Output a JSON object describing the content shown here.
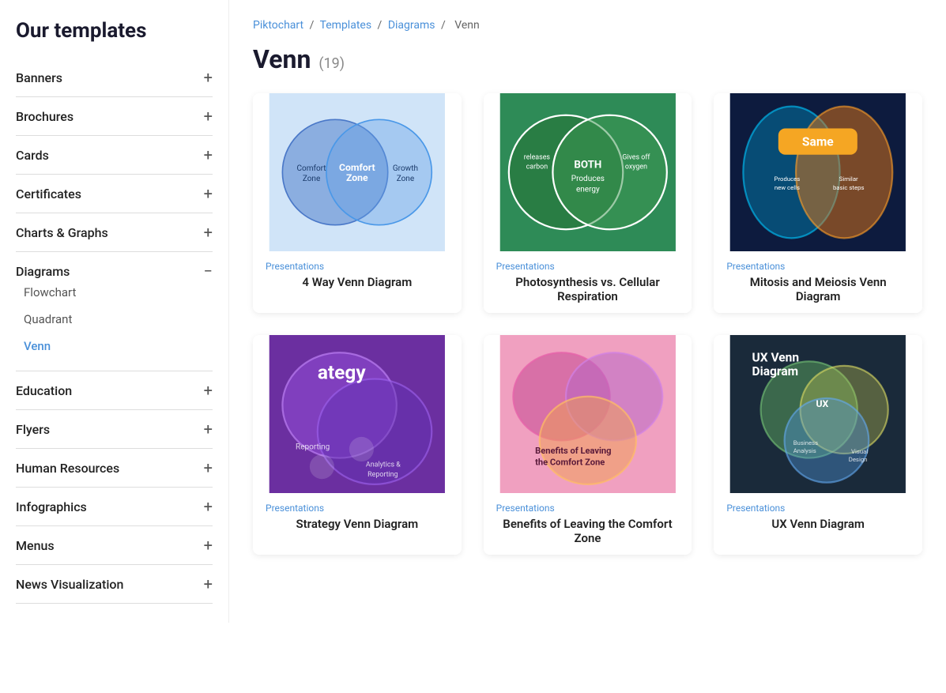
{
  "sidebar": {
    "heading": "Our templates",
    "items": [
      {
        "id": "banners",
        "label": "Banners",
        "expandable": true,
        "expanded": false,
        "subitems": []
      },
      {
        "id": "brochures",
        "label": "Brochures",
        "expandable": true,
        "expanded": false,
        "subitems": []
      },
      {
        "id": "cards",
        "label": "Cards",
        "expandable": true,
        "expanded": false,
        "subitems": []
      },
      {
        "id": "certificates",
        "label": "Certificates",
        "expandable": true,
        "expanded": false,
        "subitems": []
      },
      {
        "id": "charts-graphs",
        "label": "Charts & Graphs",
        "expandable": true,
        "expanded": false,
        "subitems": []
      },
      {
        "id": "diagrams",
        "label": "Diagrams",
        "expandable": true,
        "expanded": true,
        "subitems": [
          {
            "id": "flowchart",
            "label": "Flowchart",
            "active": false
          },
          {
            "id": "quadrant",
            "label": "Quadrant",
            "active": false
          },
          {
            "id": "venn",
            "label": "Venn",
            "active": true
          }
        ]
      },
      {
        "id": "education",
        "label": "Education",
        "expandable": true,
        "expanded": false,
        "subitems": []
      },
      {
        "id": "flyers",
        "label": "Flyers",
        "expandable": true,
        "expanded": false,
        "subitems": []
      },
      {
        "id": "human-resources",
        "label": "Human Resources",
        "expandable": true,
        "expanded": false,
        "subitems": []
      },
      {
        "id": "infographics",
        "label": "Infographics",
        "expandable": true,
        "expanded": false,
        "subitems": []
      },
      {
        "id": "menus",
        "label": "Menus",
        "expandable": true,
        "expanded": false,
        "subitems": []
      },
      {
        "id": "news-visualization",
        "label": "News Visualization",
        "expandable": true,
        "expanded": false,
        "subitems": []
      }
    ]
  },
  "breadcrumb": {
    "parts": [
      "Piktochart",
      "Templates",
      "Diagrams",
      "Venn"
    ],
    "separators": [
      "/",
      "/",
      "/"
    ]
  },
  "page": {
    "title": "Venn",
    "count": "(19)"
  },
  "templates": [
    {
      "id": "t1",
      "category": "Presentations",
      "title": "4 Way Venn Diagram",
      "theme": "blue-light"
    },
    {
      "id": "t2",
      "category": "Presentations",
      "title": "Photosynthesis vs. Cellular Respiration",
      "theme": "green"
    },
    {
      "id": "t3",
      "category": "Presentations",
      "title": "Mitosis and Meiosis Venn Diagram",
      "theme": "dark-blue"
    },
    {
      "id": "t4",
      "category": "Presentations",
      "title": "Strategy Venn Diagram",
      "theme": "purple"
    },
    {
      "id": "t5",
      "category": "Presentations",
      "title": "Benefits of Leaving the Comfort Zone",
      "theme": "pink"
    },
    {
      "id": "t6",
      "category": "Presentations",
      "title": "UX Venn Diagram",
      "theme": "dark-navy"
    }
  ]
}
